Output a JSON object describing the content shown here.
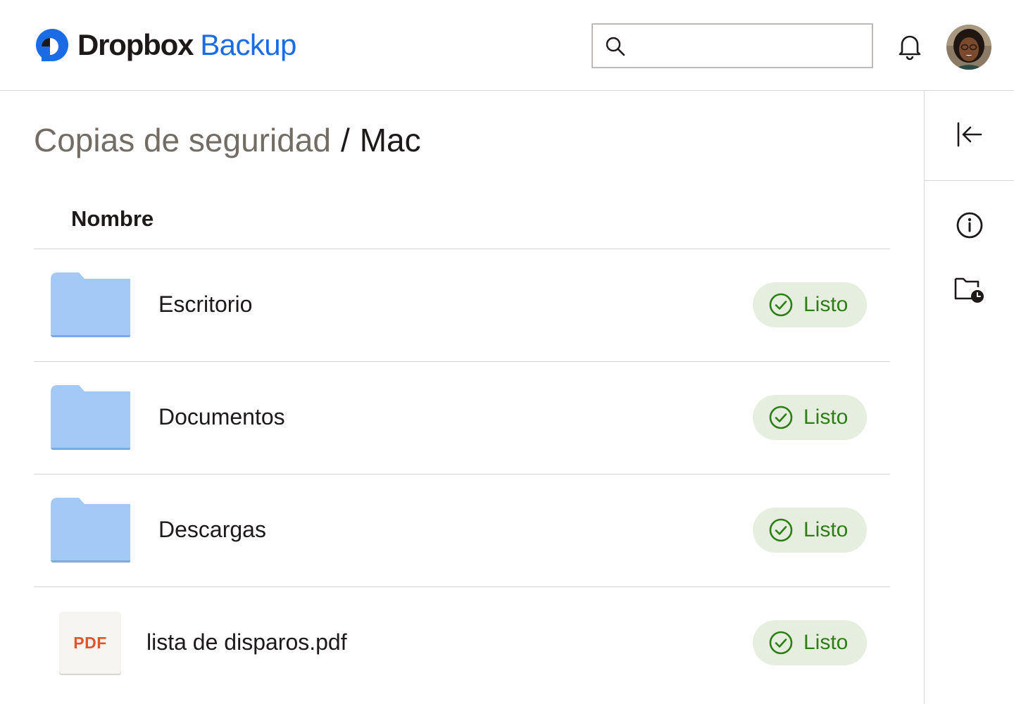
{
  "header": {
    "brand_primary": "Dropbox",
    "brand_secondary": "Backup",
    "search": {
      "value": "",
      "placeholder": ""
    },
    "icons": [
      "dropbox-logo-icon",
      "search-icon",
      "bell-icon",
      "avatar"
    ]
  },
  "breadcrumb": {
    "parent": "Copias de seguridad",
    "separator": "/",
    "current": "Mac"
  },
  "table": {
    "column_header": "Nombre",
    "rows": [
      {
        "type": "folder",
        "icon": "folder-icon",
        "name": "Escritorio",
        "status": "Listo"
      },
      {
        "type": "folder",
        "icon": "folder-icon",
        "name": "Documentos",
        "status": "Listo"
      },
      {
        "type": "folder",
        "icon": "folder-icon",
        "name": "Descargas",
        "status": "Listo"
      },
      {
        "type": "file",
        "icon": "pdf-file-icon",
        "badge_text": "PDF",
        "name": "lista de disparos.pdf",
        "status": "Listo"
      }
    ]
  },
  "rail": {
    "icons": [
      "collapse-panel-icon",
      "info-icon",
      "folder-history-icon"
    ]
  },
  "colors": {
    "brand_blue": "#1a6ce6",
    "breadcrumb_parent": "#736c64",
    "folder_blue": "#a3c9f6",
    "status_bg": "#e6efdf",
    "status_text": "#2e7d16",
    "pdf_label": "#e0552f",
    "divider": "#d9d6d3"
  }
}
